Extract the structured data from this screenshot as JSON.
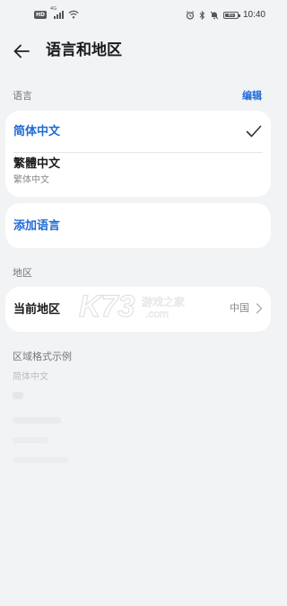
{
  "status_bar": {
    "hd": "HD",
    "signal_label": "4G",
    "battery": "80",
    "time": "10:40"
  },
  "header": {
    "title": "语言和地区"
  },
  "language_section": {
    "label": "语言",
    "edit": "编辑",
    "languages": [
      {
        "name": "简体中文",
        "selected": true
      },
      {
        "name": "繁體中文",
        "subtitle": "繁体中文",
        "selected": false
      }
    ],
    "add_language": "添加语言"
  },
  "region_section": {
    "label": "地区",
    "current_region_label": "当前地区",
    "current_region_value": "中国"
  },
  "format_section": {
    "label": "区域格式示例",
    "example": "简体中文"
  },
  "watermark": {
    "text": "K73",
    "subtext": "游戏之家",
    "domain": ".com"
  },
  "colors": {
    "accent": "#1f6ad6",
    "background": "#f1f3f5",
    "card": "#ffffff"
  }
}
